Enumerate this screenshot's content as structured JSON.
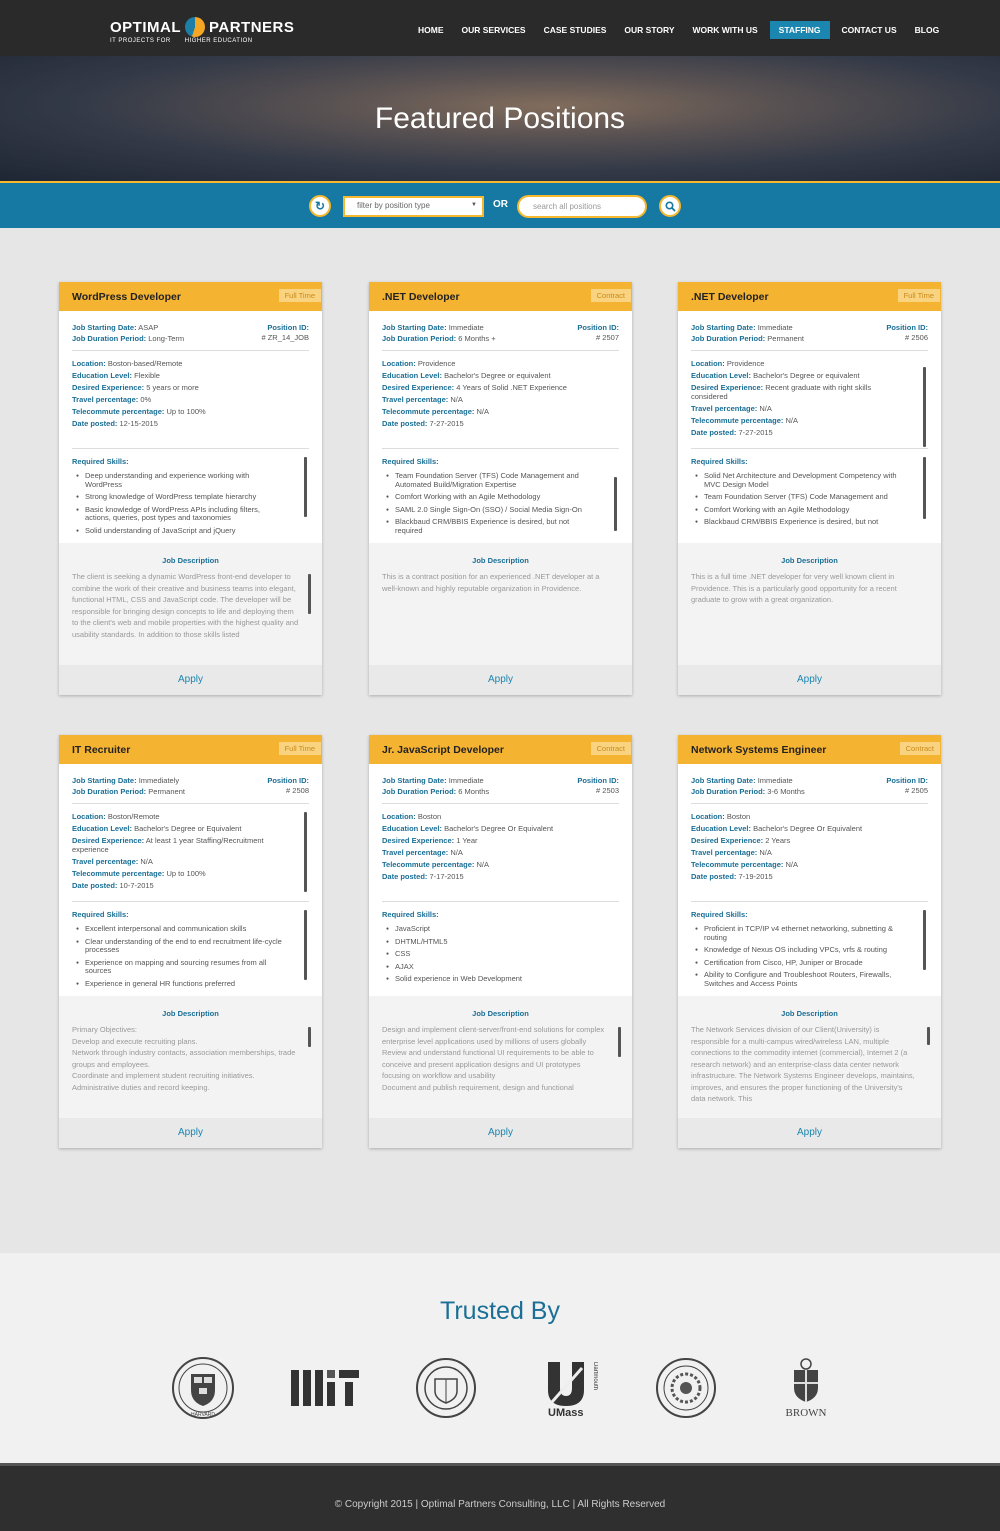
{
  "header": {
    "logo_top": "OPTIMAL PARTNERS",
    "logo_left": "OPTIMAL",
    "logo_right": "PARTNERS",
    "logo_tag_left": "IT PROJECTS FOR",
    "logo_tag_right": "HIGHER EDUCATION",
    "nav": [
      "HOME",
      "OUR SERVICES",
      "CASE STUDIES",
      "OUR STORY",
      "WORK WITH US",
      "STAFFING",
      "CONTACT US",
      "BLOG"
    ],
    "active_nav": "STAFFING"
  },
  "hero": {
    "title": "Featured Positions"
  },
  "filter": {
    "select_placeholder": "filter by position type",
    "or_label": "OR",
    "search_placeholder": "search all positions"
  },
  "labels": {
    "start": "Job Starting Date:",
    "duration": "Job Duration Period:",
    "position_id": "Position ID:",
    "location": "Location:",
    "education": "Education Level:",
    "experience": "Desired Experience:",
    "travel": "Travel percentage:",
    "telecommute": "Telecommute percentage:",
    "posted": "Date posted:",
    "skills": "Required Skills:",
    "job_description": "Job Description",
    "apply": "Apply"
  },
  "jobs": [
    {
      "title": "WordPress Developer",
      "type": "Full Time",
      "start": "ASAP",
      "duration": "Long-Term",
      "position_id": "# ZR_14_JOB",
      "location": "Boston-based/Remote",
      "education": "Flexible",
      "experience": "5 years or more",
      "travel": "0%",
      "telecommute": "Up to 100%",
      "posted": "12-15-2015",
      "skills": [
        "Deep understanding and experience working with WordPress",
        "Strong knowledge of WordPress template hierarchy",
        "Basic knowledge of WordPress APIs including filters, actions, queries, post types and taxonomies",
        "Solid understanding of JavaScript and jQuery"
      ],
      "description": "The client is seeking a dynamic WordPress front-end developer to combine the work of their creative and business teams into elegant, functional HTML, CSS and JavaScript code. The developer will be responsible for bringing design concepts to life and deploying them to the client's web and mobile properties with the highest quality and usability standards. In addition to those skills listed"
    },
    {
      "title": ".NET Developer",
      "type": "Contract",
      "start": "Immediate",
      "duration": "6 Months +",
      "position_id": "# 2507",
      "location": "Providence",
      "education": "Bachelor's Degree or equivalent",
      "experience": "4 Years of Solid .NET Experience",
      "travel": "N/A",
      "telecommute": "N/A",
      "posted": "7-27-2015",
      "skills": [
        "Team Foundation Server (TFS) Code Management and Automated Build/Migration Expertise",
        "Comfort Working with an Agile Methodology",
        "SAML 2.0 Single Sign-On (SSO) / Social Media Sign-On",
        "Blackbaud CRM/BBIS Experience is desired, but not required"
      ],
      "description": "This is a contract position for an experienced .NET developer at a well-known and highly reputable organization in Providence."
    },
    {
      "title": ".NET Developer",
      "type": "Full Time",
      "start": "Immediate",
      "duration": "Permanent",
      "position_id": "# 2506",
      "location": "Providence",
      "education": "Bachelor's Degree or equivalent",
      "experience": "Recent graduate with right skills considered",
      "travel": "N/A",
      "telecommute": "N/A",
      "posted": "7-27-2015",
      "skills": [
        "Solid Net Architecture and Development Competency with MVC Design Model",
        "Team Foundation Server (TFS) Code Management and",
        "Comfort Working with an Agile Methodology",
        "Blackbaud CRM/BBIS Experience is desired, but not"
      ],
      "description": "This is a full time .NET developer for very well known client in Providence. This is a particularly good opportunity for a recent graduate to grow with a great organization."
    },
    {
      "title": "IT Recruiter",
      "type": "Full Time",
      "start": "Immediately",
      "duration": "Permanent",
      "position_id": "# 2508",
      "location": "Boston/Remote",
      "education": "Bachelor's Degree or Equivalent",
      "experience": "At least 1 year Staffing/Recruitment experience",
      "travel": "N/A",
      "telecommute": "Up to 100%",
      "posted": "10-7-2015",
      "skills": [
        "Excellent interpersonal and communication skills",
        "Clear understanding of the end to end recruitment life-cycle processes",
        "Experience on mapping and sourcing resumes from all sources",
        "Experience in general HR functions preferred"
      ],
      "description": "Primary Objectives:\nDevelop and execute recruiting plans.\nNetwork through industry contacts, association memberships, trade groups and employees.\nCoordinate and implement student recruiting initiatives.\nAdministrative duties and record keeping."
    },
    {
      "title": "Jr. JavaScript Developer",
      "type": "Contract",
      "start": "Immediate",
      "duration": "6 Months",
      "position_id": "# 2503",
      "location": "Boston",
      "education": "Bachelor's Degree Or Equivalent",
      "experience": "1 Year",
      "travel": "N/A",
      "telecommute": "N/A",
      "posted": "7-17-2015",
      "skills": [
        "JavaScript",
        "DHTML/HTML5",
        "CSS",
        "AJAX",
        "Solid experience in Web Development"
      ],
      "description": "Design and implement client-server/front-end solutions for complex enterprise level applications used by millions of users globally\nReview and understand functional UI requirements to be able to conceive and present application designs and UI prototypes focusing on workflow and usability\nDocument and publish requirement, design and functional"
    },
    {
      "title": "Network Systems Engineer",
      "type": "Contract",
      "start": "Immediate",
      "duration": "3-6 Months",
      "position_id": "# 2505",
      "location": "Boston",
      "education": "Bachelor's Degree Or Equivalent",
      "experience": "2 Years",
      "travel": "N/A",
      "telecommute": "N/A",
      "posted": "7-19-2015",
      "skills": [
        "Proficient in TCP/IP v4 ethernet networking, subnetting & routing",
        "Knowledge of Nexus OS including VPCs, vrfs & routing",
        "Certification from Cisco, HP, Juniper or Brocade",
        "Ability to Configure and Troubleshoot Routers, Firewalls, Switches and Access Points"
      ],
      "description": "The Network Services division of our Client(University) is responsible for a multi-campus wired/wireless LAN, multiple connections to the commodity internet (commercial), Internet 2 (a research network) and an enterprise-class data center network infrastructure. The Network Systems Engineer develops, maintains, improves, and ensures the proper functioning of the University's data network. This"
    }
  ],
  "trusted": {
    "title": "Trusted By",
    "logos": [
      "Harvard",
      "MIT",
      "Boston College",
      "UMass Dartmouth",
      "Northeastern University",
      "Brown"
    ],
    "harvard_text": "HARVARD",
    "mit_text": "MIT",
    "umass_text": "UMass",
    "dartmouth_text": "Dartmouth",
    "brown_text": "BROWN"
  },
  "footer": {
    "text": "© Copyright 2015 | Optimal Partners Consulting, LLC | All Rights Reserved"
  },
  "colors": {
    "accent": "#f5b332",
    "primary": "#1579a3",
    "dark": "#2a2a2a"
  }
}
